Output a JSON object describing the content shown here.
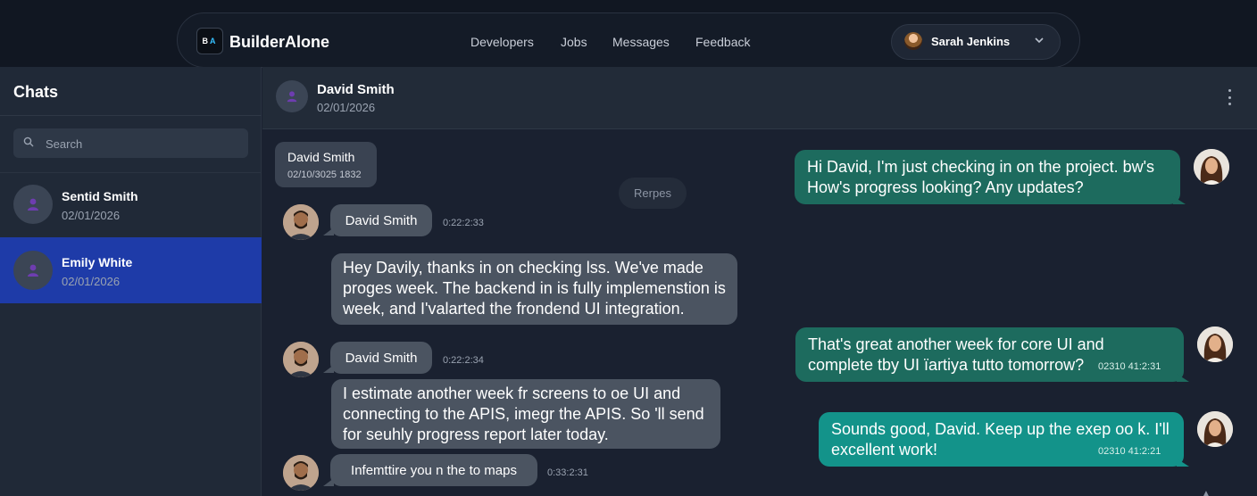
{
  "nav": {
    "logo_left": "B",
    "logo_right": "A",
    "brand": "BuilderAlone",
    "links": [
      "Developers",
      "Jobs",
      "Messages",
      "Feedback"
    ],
    "user_name": "Sarah Jenkins"
  },
  "sidebar": {
    "title": "Chats",
    "search_placeholder": "Search",
    "items": [
      {
        "name": "Sentid Smith",
        "date": "02/01/2026"
      },
      {
        "name": "Emily White",
        "date": "02/01/2026"
      }
    ]
  },
  "chat_header": {
    "name": "David Smith",
    "date": "02/01/2026"
  },
  "messages": {
    "name_card": {
      "name": "David Smith",
      "time": "02/10/3025 1832"
    },
    "replies_label": "Rerpes",
    "incoming": [
      {
        "sender": "David Smith",
        "time": "0:22:2:33",
        "text": "Hey Davily, thanks in on checking lss. We've made proges week. The backend in is fully implemenstion is week, and I'valarted the frondend UI integration."
      },
      {
        "sender": "David Smith",
        "time": "0:22:2:34",
        "text": "I estimate another week fr screens to oe UI and connecting to the APIS, imegr the APIS. So 'll send for seuhly progress report later today."
      },
      {
        "sender": "",
        "time": "0:33:2:31",
        "text": "Infemttire you n the to maps"
      }
    ],
    "outgoing": [
      {
        "text": "Hi David, I'm just checking in on the project. bw's How's progress looking? Any updates?",
        "time": ""
      },
      {
        "text": "That's great another week for core UI and complete tby UI ïartiya tutto tomorrow?",
        "time": "02310 41:2:31"
      },
      {
        "text": "Sounds good, David. Keep up the exep oo k. I'll excellent work!",
        "time": "02310 41:2:21"
      }
    ]
  },
  "colors": {
    "active_chat": "#1e3ba8",
    "outgoing_green": "#1d6b5e",
    "outgoing_teal": "#13938a",
    "incoming_grey": "#4b5461"
  }
}
